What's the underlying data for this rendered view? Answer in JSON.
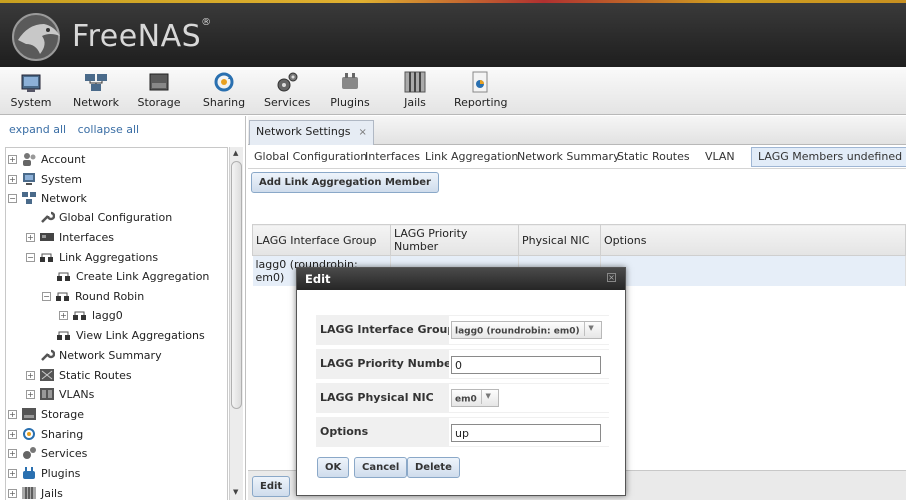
{
  "app": {
    "logo_text": "FreeNAS",
    "reg_mark": "®"
  },
  "toolbar": {
    "items": [
      {
        "label": "System",
        "icon": "system-icon"
      },
      {
        "label": "Network",
        "icon": "network-icon"
      },
      {
        "label": "Storage",
        "icon": "storage-icon"
      },
      {
        "label": "Sharing",
        "icon": "sharing-icon"
      },
      {
        "label": "Services",
        "icon": "services-icon"
      },
      {
        "label": "Plugins",
        "icon": "plugins-icon"
      },
      {
        "label": "Jails",
        "icon": "jails-icon"
      },
      {
        "label": "Reporting",
        "icon": "reporting-icon"
      }
    ]
  },
  "sidebar": {
    "expand_all": "expand all",
    "collapse_all": "collapse all",
    "tree": [
      {
        "label": "Account",
        "toggle": "+"
      },
      {
        "label": "System",
        "toggle": "+"
      },
      {
        "label": "Network",
        "toggle": "−"
      },
      {
        "label": "Global Configuration",
        "toggle": ""
      },
      {
        "label": "Interfaces",
        "toggle": "+"
      },
      {
        "label": "Link Aggregations",
        "toggle": "−"
      },
      {
        "label": "Create Link Aggregation",
        "toggle": ""
      },
      {
        "label": "Round Robin",
        "toggle": "−"
      },
      {
        "label": "lagg0",
        "toggle": "+"
      },
      {
        "label": "View Link Aggregations",
        "toggle": ""
      },
      {
        "label": "Network Summary",
        "toggle": ""
      },
      {
        "label": "Static Routes",
        "toggle": "+"
      },
      {
        "label": "VLANs",
        "toggle": "+"
      },
      {
        "label": "Storage",
        "toggle": "+"
      },
      {
        "label": "Sharing",
        "toggle": "+"
      },
      {
        "label": "Services",
        "toggle": "+"
      },
      {
        "label": "Plugins",
        "toggle": "+"
      },
      {
        "label": "Jails",
        "toggle": "+"
      }
    ]
  },
  "main": {
    "tab_label": "Network Settings",
    "tab_close": "×",
    "subtabs": [
      "Global Configuration",
      "Interfaces",
      "Link Aggregation",
      "Network Summary",
      "Static Routes",
      "VLAN"
    ],
    "active_subtab": "LAGG Members undefined",
    "active_subtab_close": "×",
    "add_button": "Add Link Aggregation Member",
    "table": {
      "columns": [
        "LAGG Interface Group",
        "LAGG Priority Number",
        "Physical NIC",
        "Options"
      ],
      "rows": [
        [
          "lagg0 (roundrobin: em0)",
          "0",
          "em0",
          "up"
        ]
      ]
    },
    "bottom_edit": "Edit"
  },
  "dialog": {
    "title": "Edit",
    "close": "×",
    "fields": {
      "interface_group": {
        "label": "LAGG Interface Group",
        "value": "lagg0 (roundrobin: em0)"
      },
      "priority": {
        "label": "LAGG Priority Number",
        "value": "0"
      },
      "physical_nic": {
        "label": "LAGG Physical NIC",
        "value": "em0"
      },
      "options": {
        "label": "Options",
        "value": "up"
      }
    },
    "ok": "OK",
    "cancel": "Cancel",
    "delete": "Delete"
  }
}
